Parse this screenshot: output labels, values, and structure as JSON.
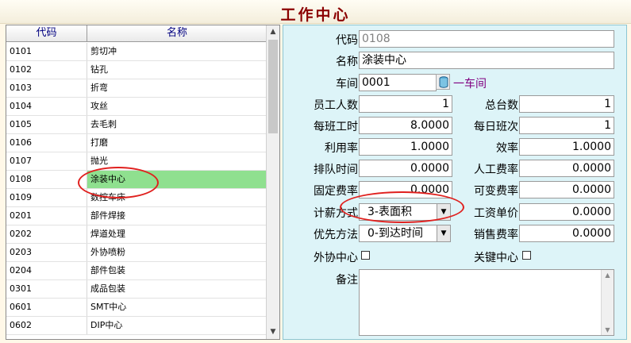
{
  "window": {
    "title": "工作中心"
  },
  "list": {
    "columns": [
      "代码",
      "名称"
    ],
    "selected_code": "0108",
    "rows": [
      {
        "code": "0101",
        "name": "剪切冲"
      },
      {
        "code": "0102",
        "name": "钻孔"
      },
      {
        "code": "0103",
        "name": "折弯"
      },
      {
        "code": "0104",
        "name": "攻丝"
      },
      {
        "code": "0105",
        "name": "去毛刺"
      },
      {
        "code": "0106",
        "name": "打磨"
      },
      {
        "code": "0107",
        "name": "抛光"
      },
      {
        "code": "0108",
        "name": "涂装中心"
      },
      {
        "code": "0109",
        "name": "数控车床"
      },
      {
        "code": "0201",
        "name": "部件焊接"
      },
      {
        "code": "0202",
        "name": "焊道处理"
      },
      {
        "code": "0203",
        "name": "外协喷粉"
      },
      {
        "code": "0204",
        "name": "部件包装"
      },
      {
        "code": "0301",
        "name": "成品包装"
      },
      {
        "code": "0601",
        "name": "SMT中心"
      },
      {
        "code": "0602",
        "name": "DIP中心"
      }
    ],
    "scroll_up_icon": "▲",
    "scroll_down_icon": "▼"
  },
  "form": {
    "code_label": "代码",
    "code_value": "0108",
    "name_label": "名称",
    "name_value": "涂装中心",
    "workshop_label": "车间",
    "workshop_code": "0001",
    "workshop_name": "一车间",
    "staff_label": "员工人数",
    "staff_value": "1",
    "machines_label": "总台数",
    "machines_value": "1",
    "shift_hours_label": "每班工时",
    "shift_hours_value": "8.0000",
    "shifts_label": "每日班次",
    "shifts_value": "1",
    "utilization_label": "利用率",
    "utilization_value": "1.0000",
    "efficiency_label": "效率",
    "efficiency_value": "1.0000",
    "queue_label": "排队时间",
    "queue_value": "0.0000",
    "labor_rate_label": "人工费率",
    "labor_rate_value": "0.0000",
    "fixed_rate_label": "固定费率",
    "fixed_rate_value": "0.0000",
    "variable_rate_label": "可变费率",
    "variable_rate_value": "0.0000",
    "pay_method_label": "计薪方式",
    "pay_method_value": "3-表面积",
    "wage_price_label": "工资单价",
    "wage_price_value": "0.0000",
    "priority_label": "优先方法",
    "priority_value": "0-到达时间",
    "sales_rate_label": "销售费率",
    "sales_rate_value": "0.0000",
    "outsource_label": "外协中心",
    "key_center_label": "关键中心",
    "memo_label": "备注",
    "dropdown_icon": "▼"
  },
  "colors": {
    "title": "#8B0000",
    "selected_row": "#8FE08F",
    "panel": "#DDF4F8",
    "link": "#800080",
    "annotation": "#E0201E"
  }
}
